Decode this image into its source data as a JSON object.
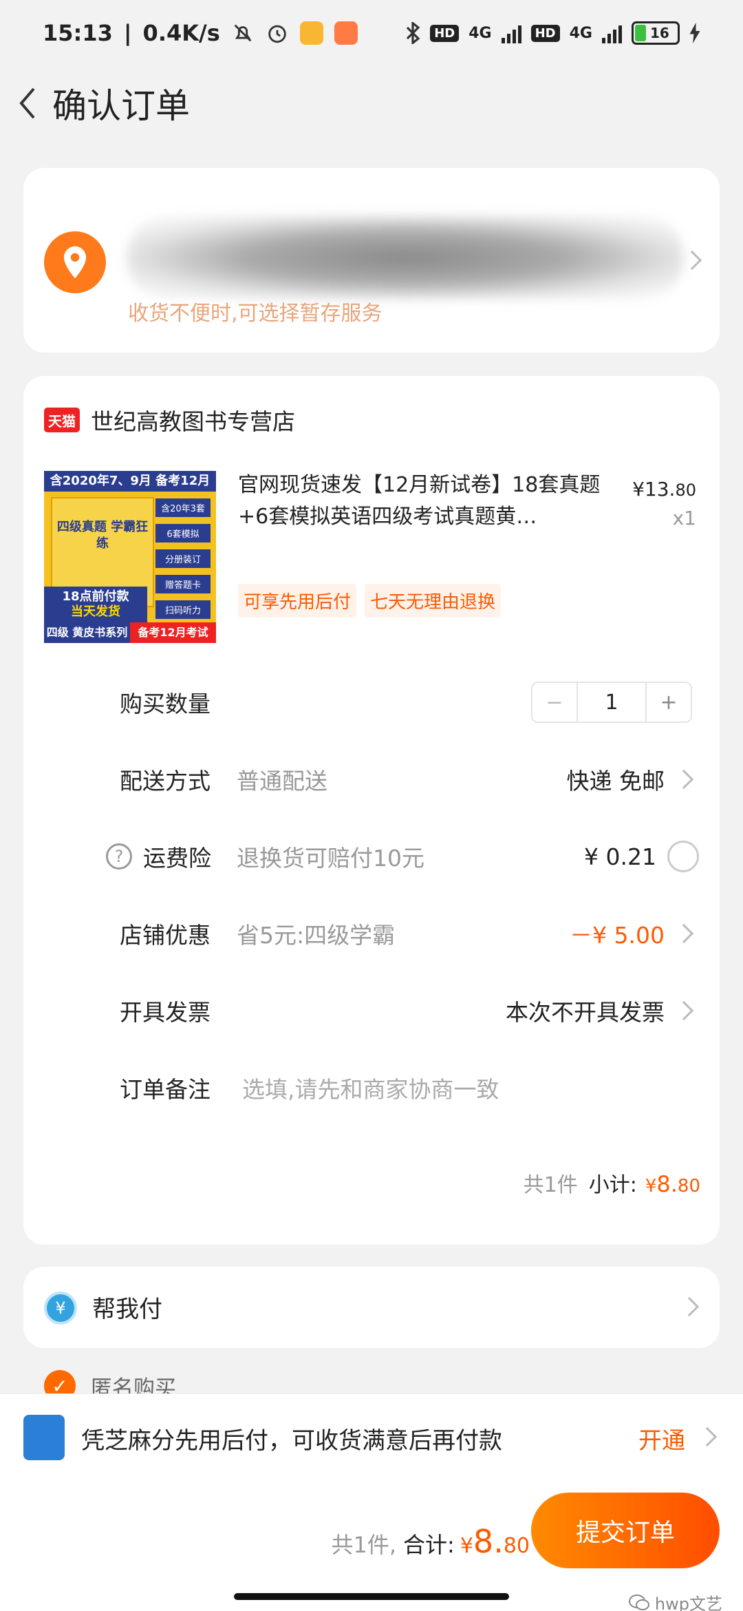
{
  "status_bar": {
    "time": "15:13",
    "speed": "0.4K/s",
    "net1": "4G",
    "net2": "4G",
    "hd1": "HD",
    "hd2": "HD",
    "battery": "16"
  },
  "header": {
    "title": "确认订单"
  },
  "address": {
    "hint": "收货不便时,可选择暂存服务"
  },
  "store": {
    "badge": "天猫",
    "name": "世纪高教图书专营店"
  },
  "product": {
    "image_top": "含2020年7、9月 备考12月",
    "image_book": "四级真题 学霸狂练",
    "image_badges": [
      "含20年3套",
      "6套模拟",
      "分册装订",
      "赠答题卡",
      "扫码听力"
    ],
    "image_banner_a": "18点前付款",
    "image_banner_b": "当天发货",
    "image_bottom_left": "四级 黄皮书系列",
    "image_bottom_right": "备考12月考试",
    "title": "官网现货速发【12月新试卷】18套真题+6套模拟英语四级考试真题黄…",
    "price_int": "¥13.",
    "price_dec": "80",
    "qty": "x1",
    "tags": [
      "可享先用后付",
      "七天无理由退换"
    ]
  },
  "rows": {
    "quantity": {
      "label": "购买数量",
      "minus": "−",
      "value": "1",
      "plus": "+"
    },
    "delivery": {
      "label": "配送方式",
      "sub": "普通配送",
      "value": "快递 免邮"
    },
    "insurance": {
      "label": "运费险",
      "sub": "退换货可赔付10元",
      "value": "¥ 0.21",
      "help": "?"
    },
    "discount": {
      "label": "店铺优惠",
      "sub": "省5元:四级学霸",
      "value": "－¥ 5.00"
    },
    "invoice": {
      "label": "开具发票",
      "value": "本次不开具发票"
    },
    "note": {
      "label": "订单备注",
      "placeholder": "选填,请先和商家协商一致"
    }
  },
  "subtotal": {
    "count": "共1件",
    "label": "小计:",
    "currency": "¥",
    "amount": "8.",
    "cents": "80"
  },
  "help_pay": {
    "icon": "¥",
    "label": "帮我付"
  },
  "anonymous": {
    "label": "匿名购买",
    "check": "✓"
  },
  "promo": {
    "text": "凭芝麻分先用后付，可收货满意后再付款",
    "action": "开通"
  },
  "footer": {
    "count": "共1件,",
    "label": "合计:",
    "currency": "¥",
    "amount": "8.",
    "cents": "80",
    "submit": "提交订单",
    "watermark": "hwp文艺"
  },
  "colors": {
    "accent": "#ff5a00",
    "button_start": "#ff8a00",
    "button_end": "#ff4d00",
    "tmall_red": "#e22222"
  }
}
